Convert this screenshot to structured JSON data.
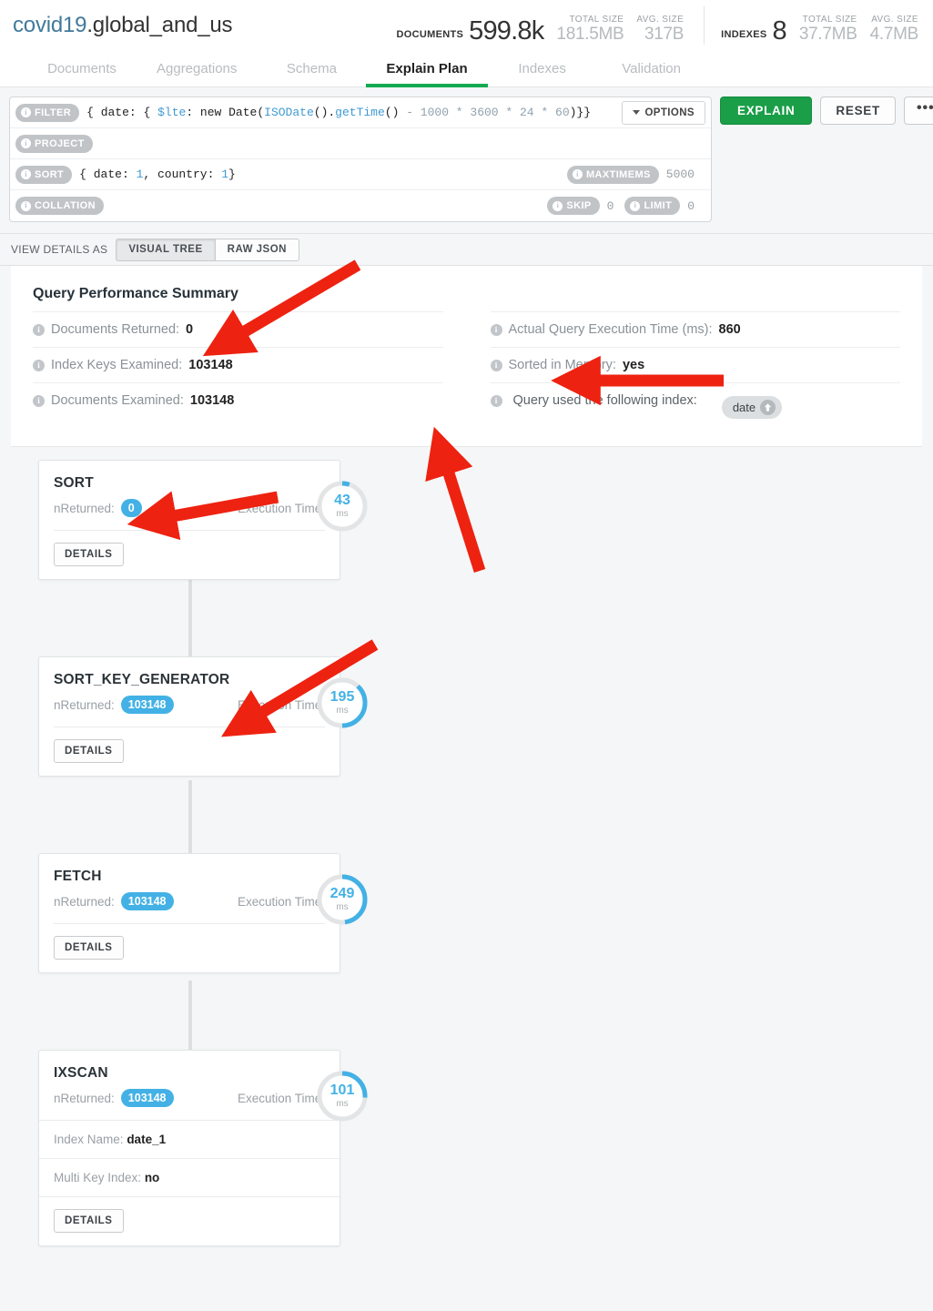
{
  "header": {
    "namespace_db": "covid19",
    "namespace_sep": ".",
    "namespace_coll": "global_and_us",
    "documents_label": "DOCUMENTS",
    "documents_value": "599.8k",
    "documents_total_size_label": "TOTAL SIZE",
    "documents_total_size": "181.5MB",
    "documents_avg_size_label": "AVG. SIZE",
    "documents_avg_size": "317B",
    "indexes_label": "INDEXES",
    "indexes_value": "8",
    "indexes_total_size_label": "TOTAL SIZE",
    "indexes_total_size": "37.7MB",
    "indexes_avg_size_label": "AVG. SIZE",
    "indexes_avg_size": "4.7MB"
  },
  "tabs": [
    {
      "label": "Documents",
      "active": false
    },
    {
      "label": "Aggregations",
      "active": false
    },
    {
      "label": "Schema",
      "active": false
    },
    {
      "label": "Explain Plan",
      "active": true
    },
    {
      "label": "Indexes",
      "active": false
    },
    {
      "label": "Validation",
      "active": false
    }
  ],
  "query": {
    "filter_label": "FILTER",
    "filter_code_plain_1": "{ date: { ",
    "filter_code_kw": "$lte",
    "filter_code_plain_2": ": new Date(",
    "filter_code_fn1": "ISODate",
    "filter_code_plain_3": "().",
    "filter_code_fn2": "getTime",
    "filter_code_plain_4": "() ",
    "filter_code_nums": "- 1000 * 3600 * 24 * 60",
    "filter_code_plain_5": ")}}",
    "project_label": "PROJECT",
    "project_value": "",
    "sort_label": "SORT",
    "sort_code_open": "{ date: ",
    "sort_code_n1": "1",
    "sort_code_mid": ", country: ",
    "sort_code_n2": "1",
    "sort_code_close": "}",
    "maxtimems_label": "MAXTIMEMS",
    "maxtimems_value": "5000",
    "collation_label": "COLLATION",
    "collation_value": "",
    "skip_label": "SKIP",
    "skip_value": "0",
    "limit_label": "LIMIT",
    "limit_value": "0",
    "options_label": "OPTIONS",
    "explain_label": "EXPLAIN",
    "reset_label": "RESET",
    "more_label": "•••"
  },
  "viewbar": {
    "label": "VIEW DETAILS AS",
    "visual_tree_label": "VISUAL TREE",
    "raw_json_label": "RAW JSON"
  },
  "summary": {
    "title": "Query Performance Summary",
    "documents_returned_label": "Documents Returned:",
    "documents_returned_value": "0",
    "index_keys_examined_label": "Index Keys Examined:",
    "index_keys_examined_value": "103148",
    "documents_examined_label": "Documents Examined:",
    "documents_examined_value": "103148",
    "execution_time_label": "Actual Query Execution Time (ms):",
    "execution_time_value": "860",
    "sorted_in_memory_label": "Sorted in Memory:",
    "sorted_in_memory_value": "yes",
    "index_used_label": "Query used the following index:",
    "index_name": "date"
  },
  "stages": [
    {
      "name": "SORT",
      "nreturned_label": "nReturned:",
      "nreturned": "0",
      "exec_label": "Execution Time:",
      "exec_ms": "43",
      "exec_unit": "ms",
      "arc_fraction": 0.05,
      "details_label": "DETAILS",
      "extra_rows": []
    },
    {
      "name": "SORT_KEY_GENERATOR",
      "nreturned_label": "nReturned:",
      "nreturned": "103148",
      "exec_label": "Execution Time:",
      "exec_ms": "195",
      "exec_unit": "ms",
      "arc_fraction": 0.38,
      "details_label": "DETAILS",
      "extra_rows": []
    },
    {
      "name": "FETCH",
      "nreturned_label": "nReturned:",
      "nreturned": "103148",
      "exec_label": "Execution Time:",
      "exec_ms": "249",
      "exec_unit": "ms",
      "arc_fraction": 0.48,
      "details_label": "DETAILS",
      "extra_rows": []
    },
    {
      "name": "IXSCAN",
      "nreturned_label": "nReturned:",
      "nreturned": "103148",
      "exec_label": "Execution Time:",
      "exec_ms": "101",
      "exec_unit": "ms",
      "arc_fraction": 0.26,
      "details_label": "DETAILS",
      "extra_rows": [
        {
          "label": "Index Name:",
          "value": "date_1"
        },
        {
          "label": "Multi Key Index:",
          "value": "no"
        }
      ]
    }
  ],
  "colors": {
    "accent_green": "#13aa52",
    "accent_blue": "#43b1e5",
    "link_blue": "#41799b",
    "annotation_red": "#ee2211",
    "page_bg": "#f5f6f7"
  },
  "annotations": [
    {
      "name": "arrow-to-documents-returned"
    },
    {
      "name": "arrow-to-sorted-in-memory"
    },
    {
      "name": "arrow-to-index-badge"
    },
    {
      "name": "arrow-to-sort-stage"
    },
    {
      "name": "arrow-to-sort-key-generator-stage"
    }
  ]
}
